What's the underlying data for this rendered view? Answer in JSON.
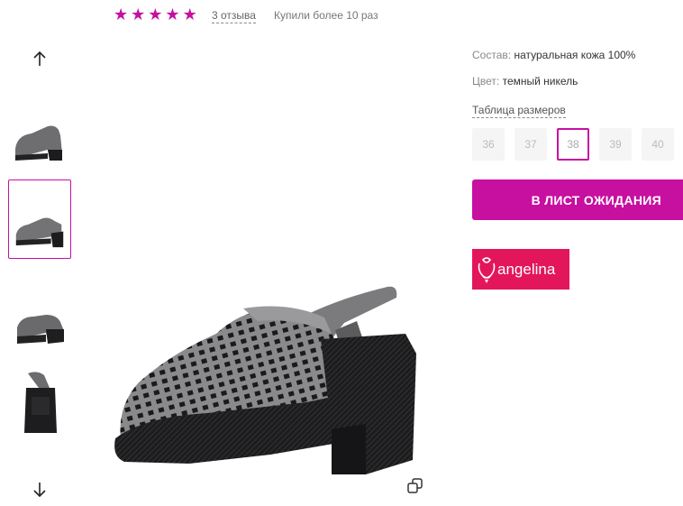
{
  "rating": {
    "stars": [
      "★",
      "★",
      "★",
      "★",
      "★"
    ],
    "reviews_label": "3 отзыва",
    "bought_label": "Купили более 10 раз",
    "accent_color": "#c70fa0"
  },
  "gallery": {
    "icons": {
      "prev": "arrow-up-icon",
      "next": "arrow-down-icon",
      "zoom": "zoom-icon"
    },
    "selected_index": 1
  },
  "product": {
    "composition_label": "Состав:",
    "composition_value": "натуральная кожа 100%",
    "color_label": "Цвет:",
    "color_value": "темный никель",
    "size_table_label": "Таблица размеров",
    "sizes": [
      "36",
      "37",
      "38",
      "39",
      "40"
    ],
    "selected_size": "38",
    "waitlist_button": "В ЛИСТ ОЖИДАНИЯ"
  },
  "brand": {
    "name": "angelina",
    "background": "#e3165b"
  }
}
